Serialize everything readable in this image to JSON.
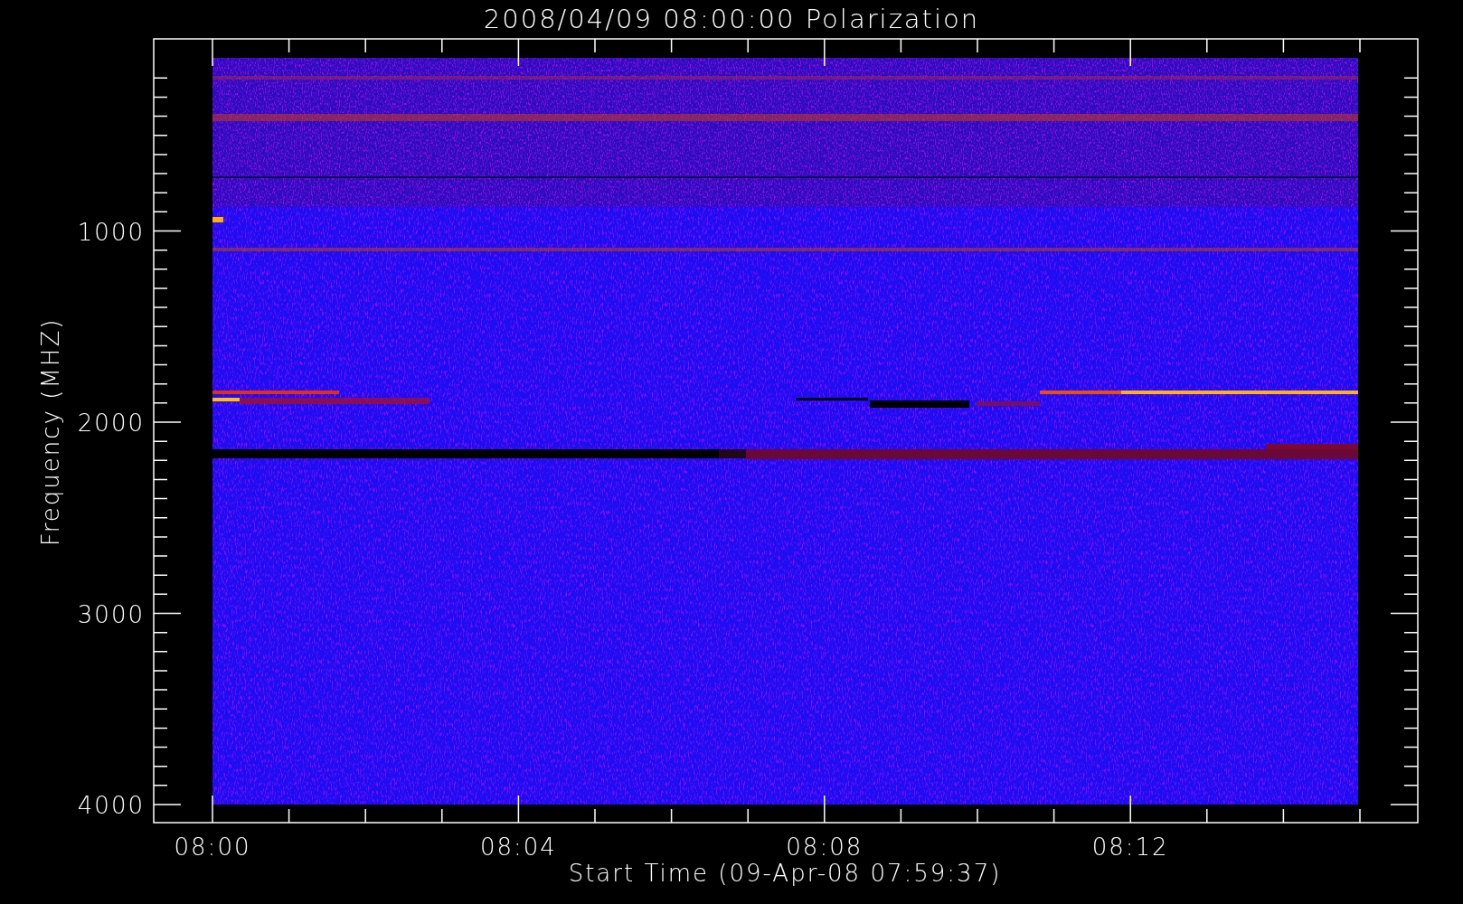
{
  "title": "2008/04/09 08:00:00 Polarization",
  "ylabel": "Frequency (MHZ)",
  "xlabel": "Start Time (09-Apr-08 07:59:37)",
  "yticks": [
    "1000",
    "2000",
    "3000",
    "4000"
  ],
  "xticks": [
    "08:00",
    "08:04",
    "08:08",
    "08:12"
  ]
}
